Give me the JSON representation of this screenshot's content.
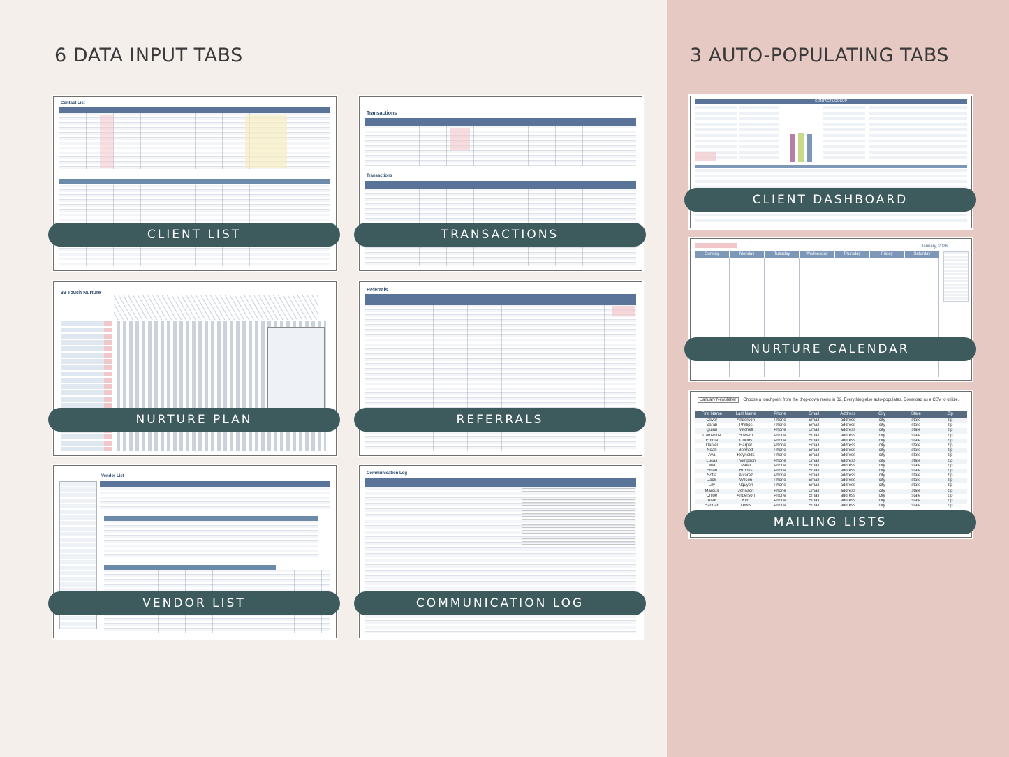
{
  "left_heading": "6 DATA INPUT TABS",
  "right_heading": "3 AUTO-POPULATING TABS",
  "input_tabs": [
    {
      "label": "CLIENT LIST",
      "sheet_title": "Contact List"
    },
    {
      "label": "TRANSACTIONS",
      "sheet_title": "Transactions"
    },
    {
      "label": "NURTURE PLAN",
      "sheet_title": "33 Touch Nurture"
    },
    {
      "label": "REFERRALS",
      "sheet_title": "Referrals"
    },
    {
      "label": "VENDOR LIST",
      "sheet_title": "Vendor List"
    },
    {
      "label": "COMMUNICATION LOG",
      "sheet_title": "Communication Log"
    }
  ],
  "auto_tabs": [
    {
      "label": "CLIENT DASHBOARD",
      "sheet_title": "CONTACT LOOKUP"
    },
    {
      "label": "NURTURE CALENDAR",
      "sheet_title": "January, 2026"
    },
    {
      "label": "MAILING LISTS",
      "sheet_title": "January Newsletter"
    }
  ],
  "calendar": {
    "days": [
      "Sunday",
      "Monday",
      "Tuesday",
      "Wednesday",
      "Thursday",
      "Friday",
      "Saturday"
    ]
  },
  "mailing": {
    "select_value": "January Newsletter",
    "instruction": "Choose a touchpoint from the drop-down menu in B2. Everything else auto-populates. Download as a CSV to utilize.",
    "columns": [
      "First Name",
      "Last Name",
      "Phone",
      "Email",
      "Address",
      "City",
      "State",
      "Zip"
    ],
    "rows": [
      [
        "Oliver",
        "Anderson",
        "Phone",
        "Email",
        "address",
        "city",
        "state",
        "zip"
      ],
      [
        "Sarah",
        "Phillips",
        "Phone",
        "Email",
        "address",
        "city",
        "state",
        "zip"
      ],
      [
        "Quinn",
        "Mitchell",
        "Phone",
        "Email",
        "address",
        "city",
        "state",
        "zip"
      ],
      [
        "Catherine",
        "Howard",
        "Phone",
        "Email",
        "address",
        "city",
        "state",
        "zip"
      ],
      [
        "Emma",
        "Collins",
        "Phone",
        "Email",
        "address",
        "city",
        "state",
        "zip"
      ],
      [
        "Daniel",
        "Harper",
        "Phone",
        "Email",
        "address",
        "city",
        "state",
        "zip"
      ],
      [
        "Noah",
        "Bennett",
        "Phone",
        "Email",
        "address",
        "city",
        "state",
        "zip"
      ],
      [
        "Ava",
        "Reynolds",
        "Phone",
        "Email",
        "address",
        "city",
        "state",
        "zip"
      ],
      [
        "Lucas",
        "Thompson",
        "Phone",
        "Email",
        "address",
        "city",
        "state",
        "zip"
      ],
      [
        "Mia",
        "Patel",
        "Phone",
        "Email",
        "address",
        "city",
        "state",
        "zip"
      ],
      [
        "Ethan",
        "Brooks",
        "Phone",
        "Email",
        "address",
        "city",
        "state",
        "zip"
      ],
      [
        "Sofia",
        "Alvarez",
        "Phone",
        "Email",
        "address",
        "city",
        "state",
        "zip"
      ],
      [
        "Jack",
        "Wilson",
        "Phone",
        "Email",
        "address",
        "city",
        "state",
        "zip"
      ],
      [
        "Lily",
        "Nguyen",
        "Phone",
        "Email",
        "address",
        "city",
        "state",
        "zip"
      ],
      [
        "Marcus",
        "Johnson",
        "Phone",
        "Email",
        "address",
        "city",
        "state",
        "zip"
      ],
      [
        "Chloe",
        "Anderson",
        "Phone",
        "Email",
        "address",
        "city",
        "state",
        "zip"
      ],
      [
        "Alex",
        "Kim",
        "Phone",
        "Email",
        "address",
        "city",
        "state",
        "zip"
      ],
      [
        "Hannah",
        "Lewis",
        "Phone",
        "Email",
        "address",
        "city",
        "state",
        "zip"
      ]
    ]
  },
  "colors": {
    "left_bg": "#f4efeb",
    "right_bg": "#e6c9c2",
    "pill": "#3d5a5c",
    "sheet_header": "#5a7398"
  }
}
